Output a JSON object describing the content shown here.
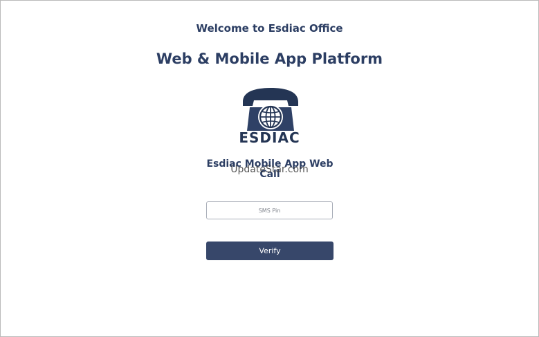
{
  "header": {
    "welcome": "Welcome to Esdiac Office",
    "platform": "Web & Mobile App Platform"
  },
  "logo": {
    "text": "ESDIAC",
    "icon": "telephone-globe-icon"
  },
  "app": {
    "title": "Esdiac Mobile App Web Call"
  },
  "watermark": "UpdateStar.com",
  "form": {
    "pin_placeholder": "SMS Pin",
    "verify_label": "Verify"
  },
  "colors": {
    "primary": "#37476a",
    "heading": "#2c3e63",
    "logo": "#243554"
  }
}
